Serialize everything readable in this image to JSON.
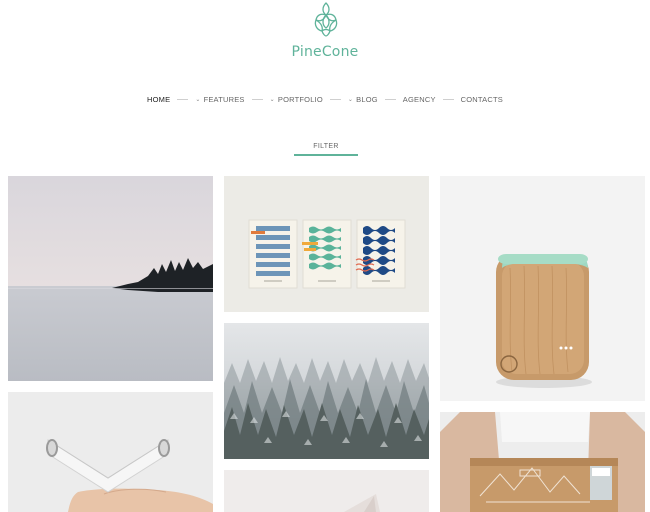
{
  "brand": {
    "name": "PineCone",
    "logo_icon": "pinecone-icon",
    "accent": "#5fb39a"
  },
  "nav": {
    "items": [
      {
        "label": "HOME",
        "has_dropdown": false,
        "active": true
      },
      {
        "label": "FEATURES",
        "has_dropdown": true,
        "active": false
      },
      {
        "label": "PORTFOLIO",
        "has_dropdown": true,
        "active": false
      },
      {
        "label": "BLOG",
        "has_dropdown": true,
        "active": false
      },
      {
        "label": "AGENCY",
        "has_dropdown": false,
        "active": false
      },
      {
        "label": "CONTACTS",
        "has_dropdown": false,
        "active": false
      }
    ]
  },
  "filter": {
    "label": "FILTER"
  },
  "portfolio": {
    "items": [
      {
        "image": "lake-island-photo"
      },
      {
        "image": "wave-posters-photo"
      },
      {
        "image": "wooden-powerbank-photo"
      },
      {
        "image": "snowy-forest-photo"
      },
      {
        "image": "white-pipe-photo"
      },
      {
        "image": "kraft-box-photo"
      },
      {
        "image": "abstract-shape-photo"
      }
    ]
  }
}
